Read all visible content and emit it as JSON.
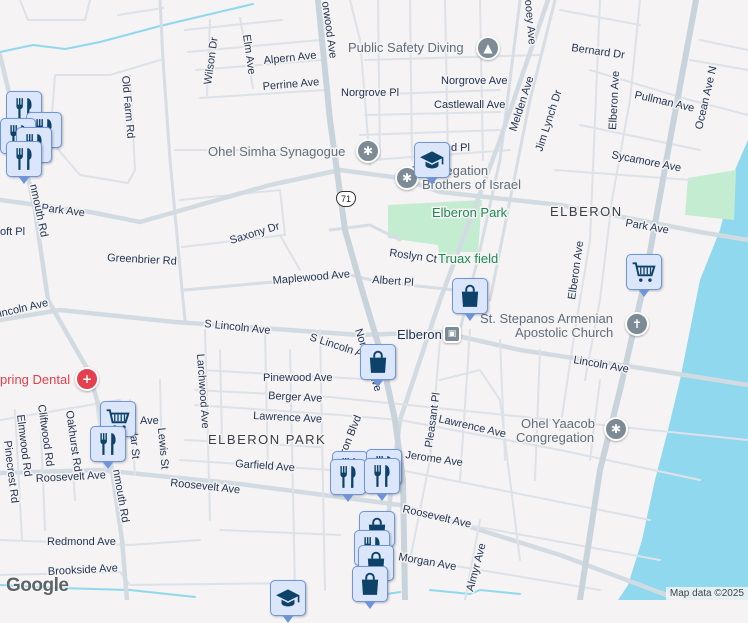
{
  "map": {
    "route_shield": "71",
    "google_logo": "Google",
    "attribution": "Map data ©2025",
    "colors": {
      "land": "#f5f3f3",
      "water": "#8fd8ee",
      "park": "#c3ecd0",
      "pin_fill": "#dbe6fb",
      "pin_border": "#6f95d8",
      "icon": "#0e4369"
    }
  },
  "streets": [
    "orwood Ave",
    "Alpern Ave",
    "Perrine Ave",
    "Norgrove Pl",
    "Norgrove Ave",
    "Castlewall Ave",
    "Wilson Dr",
    "Elm Ave",
    "Old Farm Rd",
    "Park Ave",
    "Park Ave",
    "oft Pl",
    "Saxony Dr",
    "Greenbrier Rd",
    "Maplewood Ave",
    "Albert Pl",
    "Roslyn Ct",
    "d Pl",
    "Melden Ave",
    "Jim Lynch Dr",
    "Elberon Ave",
    "Elberon Ave",
    "Bernard Dr",
    "Pullman Ave",
    "Sycamore Ave",
    "Ocean Ave N",
    "ooey Ave",
    "incoln Ave",
    "S Lincoln Ave",
    "S Lincoln Ave",
    "Lincoln Ave",
    "Pinewood Ave",
    "Berger Ave",
    "Lawrence Ave",
    "Lawrence Ave",
    "Garfield Ave",
    "Roosevelt Ave",
    "Roosevelt Ave",
    "Roosevelt Ave",
    "Jerome Ave",
    "Pleasant Pl",
    "Almyr Ave",
    "Morgan Ave",
    "Redmond Ave",
    "Brookside Ave",
    "Larchwood Ave",
    "Lewis St",
    "Oakhurst Rd",
    "Cliftwood Rd",
    "Elmwood Rd",
    "Pinecrest Rd",
    "nmouth Rd",
    "nmouth Rd",
    "dar St",
    "Ave",
    "eron Blvd",
    "Norwood Ave"
  ],
  "places": {
    "public_safety_diving": "Public Safety Diving",
    "ohel_simha": "Ohel Simha Synagogue",
    "congregation_1": "Congregation",
    "congregation_2": "Brothers of Israel",
    "elberon_park": "Elberon Park",
    "truax_field": "Truax field",
    "elberon_area": "ELBERON",
    "elberon_station": "Elberon",
    "st_stepanos_1": "St. Stepanos Armenian",
    "st_stepanos_2": "Apostolic Church",
    "dental": "pring Dental",
    "elberon_park_area": "ELBERON PARK",
    "ohel_yaacob_1": "Ohel Yaacob",
    "ohel_yaacob_2": "Congregation"
  }
}
